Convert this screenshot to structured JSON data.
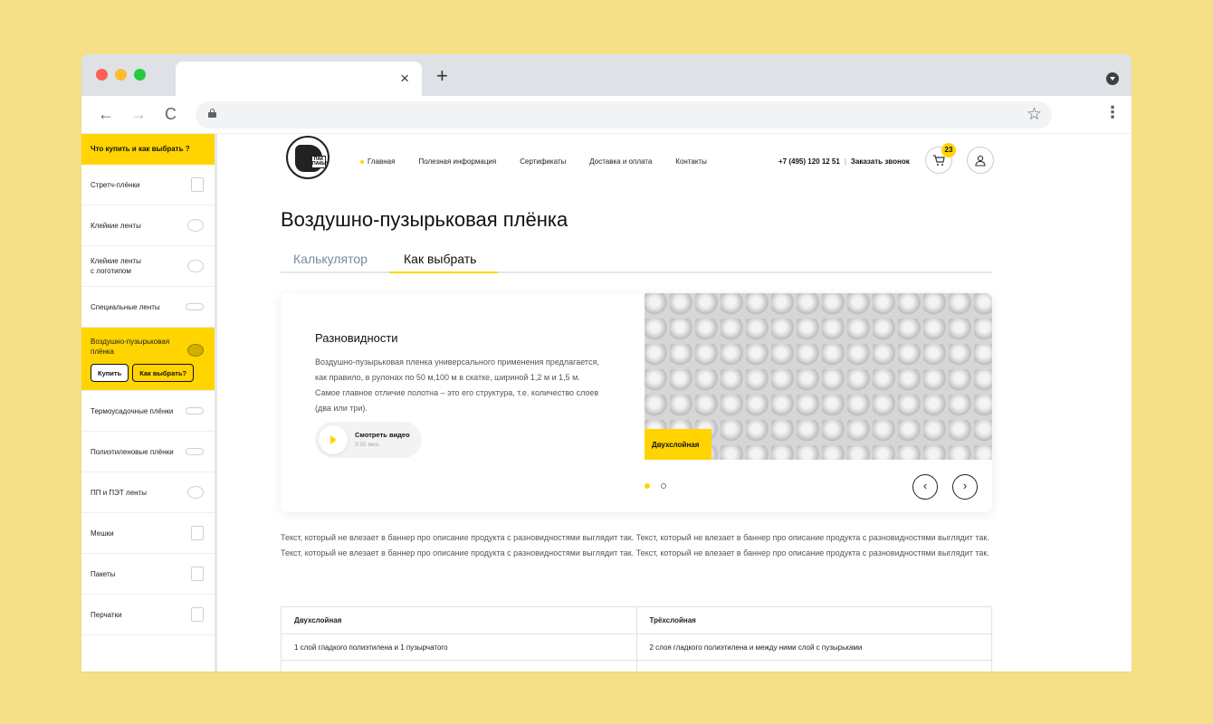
{
  "browser": {
    "tab_close": "×",
    "new_tab": "+",
    "back": "←",
    "forward": "→",
    "reload": "C",
    "bookmark": "☆",
    "menu": "⋮"
  },
  "sidebar": {
    "heading": "Что купить и как выбрать ?",
    "items": [
      {
        "label": "Стретч-плёнки"
      },
      {
        "label": "Клейкие ленты"
      },
      {
        "label": "Клейкие ленты\nс логотипом"
      },
      {
        "label": "Специальные ленты"
      },
      {
        "label": "Воздушно-пузырьковая\nплёнка",
        "buy": "Купить",
        "choose": "Как выбрать?"
      },
      {
        "label": "Термоусадочные плёнки"
      },
      {
        "label": "Полиэтиленовые плёнки"
      },
      {
        "label": "ПП и ПЭТ ленты"
      },
      {
        "label": "Мешки"
      },
      {
        "label": "Пакеты"
      },
      {
        "label": "Перчатки"
      }
    ]
  },
  "header": {
    "nav": [
      "Главная",
      "Полезная информация",
      "Сертификаты",
      "Доставка и оплата",
      "Контакты"
    ],
    "phone": "+7 (495) 120 12 51",
    "separator": "|",
    "callback": "Заказать звонок",
    "cart_count": "23",
    "logo_text": "ПАК ПАКЫЧ"
  },
  "main": {
    "title": "Воздушно-пузырьковая плёнка",
    "tabs": [
      "Калькулятор",
      "Как выбрать"
    ],
    "card": {
      "heading": "Разновидности",
      "text": "Воздушно-пузырьковая пленка универсального применения предлагается, как правило, в рулонах по 50 м,100 м в скатке, шириной 1,2 м и 1,5 м. Самое главное отличие полотна – это его структура, т.е. количество слоев (два или три).",
      "video_title": "Смотреть видео",
      "video_duration": "3:55 мин.",
      "image_label": "Двухслойная",
      "prev": "‹",
      "next": "›"
    },
    "long_text": "Текст, который не влезает в баннер про описание продукта с разновидностями выглядит так. Текст, который не влезает в баннер про описание продукта с разновидностями выглядит так. Текст, который не влезает в баннер про описание продукта с разновидностями выглядит так. Текст, который не влезает в баннер про описание продукта с разновидностями выглядит так.",
    "table": {
      "headers": [
        "Двухслойная",
        "Трёхслойная"
      ],
      "rows": [
        [
          "1 слой гладкого полиэтилена и 1 пузырчатого",
          "2 слоя гладкого полиэтилена и между ними слой с  пузырьками"
        ]
      ]
    }
  }
}
